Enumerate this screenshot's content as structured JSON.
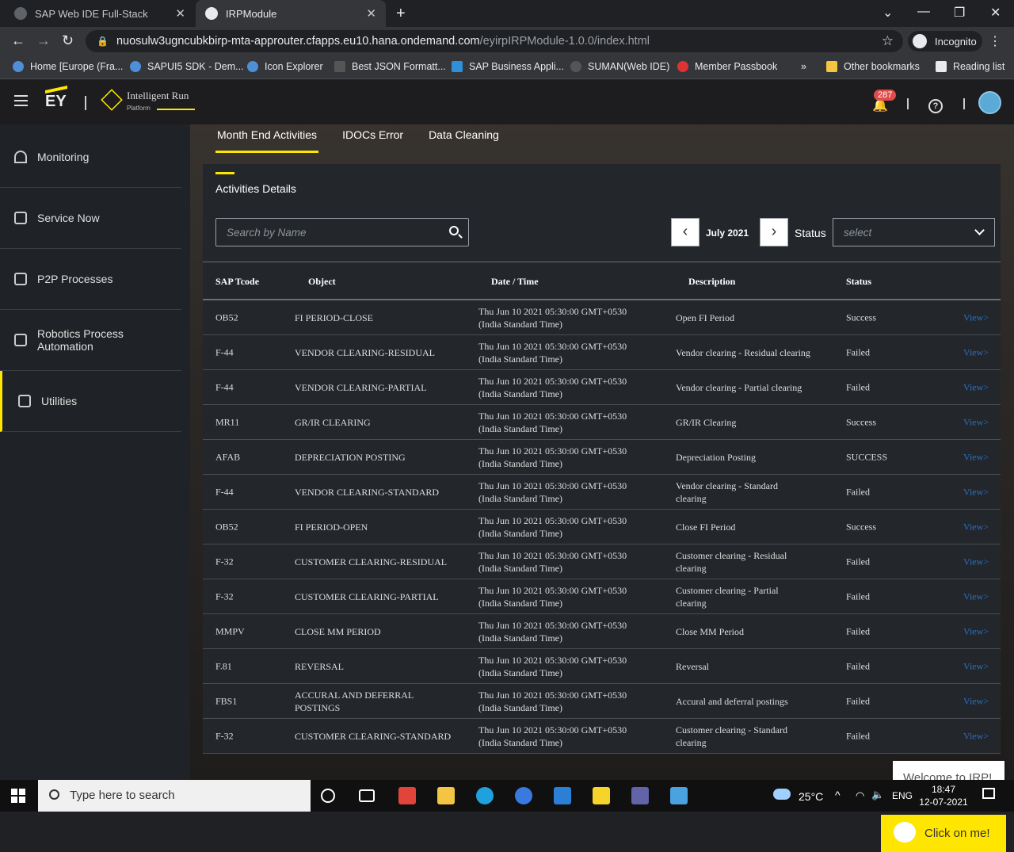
{
  "browser": {
    "tabs": [
      {
        "title": "SAP Web IDE Full-Stack",
        "active": false
      },
      {
        "title": "IRPModule",
        "active": true
      }
    ],
    "url_host": "nuosulw3ugncubkbirp-mta-approuter.cfapps.eu10.hana.ondemand.com",
    "url_path": "/eyirpIRPModule-1.0.0/index.html",
    "profile": "Incognito",
    "bookmarks": [
      "Home [Europe (Fra...",
      "SAPUI5 SDK - Dem...",
      "Icon Explorer",
      "Best JSON Formatt...",
      "SAP Business Appli...",
      "SUMAN(Web IDE)",
      "Member Passbook"
    ],
    "more": "»",
    "other_bookmarks": "Other bookmarks",
    "reading_list": "Reading list"
  },
  "header": {
    "logo": "EY",
    "product_name": "Intelligent Run",
    "product_sub": "Platform",
    "notification_count": "287"
  },
  "sidebar": {
    "items": [
      {
        "label": "Monitoring",
        "icon": "gauge-icon"
      },
      {
        "label": "Service Now",
        "icon": "clipboard-icon"
      },
      {
        "label": "P2P Processes",
        "icon": "edit-doc-icon"
      },
      {
        "label": "Robotics Process Automation",
        "icon": "robot-doc-icon"
      },
      {
        "label": "Utilities",
        "icon": "robot-doc-icon",
        "active": true
      }
    ]
  },
  "nav": {
    "tabs": [
      {
        "label": "Month End Activities",
        "active": true
      },
      {
        "label": "IDOCs Error"
      },
      {
        "label": "Data Cleaning"
      }
    ]
  },
  "panel": {
    "title": "Activities Details",
    "search_placeholder": "Search by Name",
    "month": "July 2021",
    "status_label": "Status",
    "status_placeholder": "select",
    "columns": [
      "SAP Tcode",
      "Object",
      "Date / Time",
      "Description",
      "Status"
    ],
    "view_label": "View>",
    "rows": [
      {
        "tcode": "OB52",
        "object": "FI PERIOD-CLOSE",
        "date1": "Thu Jun 10 2021 05:30:00 GMT+0530",
        "date2": "(India Standard Time)",
        "description": "Open FI Period",
        "status": "Success"
      },
      {
        "tcode": "F-44",
        "object": "VENDOR CLEARING-RESIDUAL",
        "date1": "Thu Jun 10 2021 05:30:00 GMT+0530",
        "date2": "(India Standard Time)",
        "description": "Vendor clearing - Residual clearing",
        "status": "Failed"
      },
      {
        "tcode": "F-44",
        "object": "VENDOR CLEARING-PARTIAL",
        "date1": "Thu Jun 10 2021 05:30:00 GMT+0530",
        "date2": "(India Standard Time)",
        "description": "Vendor clearing - Partial clearing",
        "status": "Failed"
      },
      {
        "tcode": "MR11",
        "object": "GR/IR CLEARING",
        "date1": "Thu Jun 10 2021 05:30:00 GMT+0530",
        "date2": "(India Standard Time)",
        "description": "GR/IR Clearing",
        "status": "Success"
      },
      {
        "tcode": "AFAB",
        "object": "DEPRECIATION POSTING",
        "date1": "Thu Jun 10 2021 05:30:00 GMT+0530",
        "date2": "(India Standard Time)",
        "description": "Depreciation Posting",
        "status": "SUCCESS"
      },
      {
        "tcode": "F-44",
        "object": "VENDOR CLEARING-STANDARD",
        "date1": "Thu Jun 10 2021 05:30:00 GMT+0530",
        "date2": "(India Standard Time)",
        "description": "Vendor clearing - Standard clearing",
        "status": "Failed"
      },
      {
        "tcode": "OB52",
        "object": "FI PERIOD-OPEN",
        "date1": "Thu Jun 10 2021 05:30:00 GMT+0530",
        "date2": "(India Standard Time)",
        "description": "Close FI Period",
        "status": "Success"
      },
      {
        "tcode": "F-32",
        "object": "CUSTOMER CLEARING-RESIDUAL",
        "date1": "Thu Jun 10 2021 05:30:00 GMT+0530",
        "date2": "(India Standard Time)",
        "description": "Customer clearing - Residual clearing",
        "status": "Failed"
      },
      {
        "tcode": "F-32",
        "object": "CUSTOMER CLEARING-PARTIAL",
        "date1": "Thu Jun 10 2021 05:30:00 GMT+0530",
        "date2": "(India Standard Time)",
        "description": "Customer clearing - Partial clearing",
        "status": "Failed"
      },
      {
        "tcode": "MMPV",
        "object": "CLOSE MM PERIOD",
        "date1": "Thu Jun 10 2021 05:30:00 GMT+0530",
        "date2": "(India Standard Time)",
        "description": "Close MM Period",
        "status": "Failed"
      },
      {
        "tcode": "F.81",
        "object": "REVERSAL",
        "date1": "Thu Jun 10 2021 05:30:00 GMT+0530",
        "date2": "(India Standard Time)",
        "description": "Reversal",
        "status": "Failed"
      },
      {
        "tcode": "FBS1",
        "object": "ACCURAL AND DEFERRAL POSTINGS",
        "date1": "Thu Jun 10 2021 05:30:00 GMT+0530",
        "date2": "(India Standard Time)",
        "description": "Accural and deferral postings",
        "status": "Failed"
      },
      {
        "tcode": "F-32",
        "object": "CUSTOMER CLEARING-STANDARD",
        "date1": "Thu Jun 10 2021 05:30:00 GMT+0530",
        "date2": "(India Standard Time)",
        "description": "Customer clearing - Standard clearing",
        "status": "Failed"
      }
    ]
  },
  "chat": {
    "bubble": "Welcome to IRP!",
    "button": "Click on me!"
  },
  "taskbar": {
    "search_placeholder": "Type here to search",
    "temperature": "25°C",
    "language": "ENG",
    "time": "18:47",
    "date": "12-07-2021"
  },
  "colors": {
    "accent": "#ffe600",
    "link": "#2a6fc2",
    "panel": "#23272b",
    "sidebar": "#1f2226"
  }
}
